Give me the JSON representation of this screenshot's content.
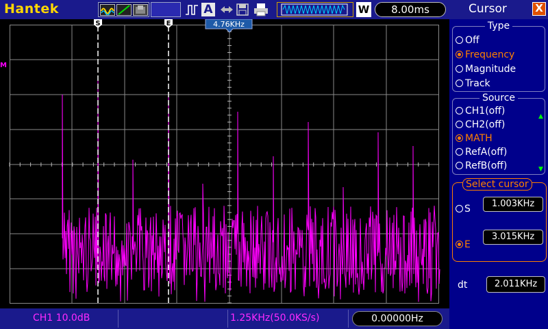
{
  "topbar": {
    "brand": "Hantek",
    "auto_label": "A",
    "w_label": "W",
    "timebase": "8.00ms"
  },
  "plot": {
    "cursor_s_label": "S",
    "cursor_e_label": "E",
    "trigger_freq_label": "4.76KHz",
    "math_marker": "M",
    "trace_color": "#ff00ff"
  },
  "status": {
    "ch1_scale": "CH1 10.0dB",
    "horizontal": "1.25KHz(50.0KS/s)",
    "frequency": "0.00000Hz"
  },
  "panel": {
    "title": "Cursor",
    "close_label": "X",
    "type_group": {
      "title": "Type",
      "options": [
        "Off",
        "Frequency",
        "Magnitude",
        "Track"
      ],
      "selected": "Frequency"
    },
    "source_group": {
      "title": "Source",
      "options": [
        "CH1(off)",
        "CH2(off)",
        "MATH",
        "RefA(off)",
        "RefB(off)"
      ],
      "selected": "MATH"
    },
    "select_cursor": {
      "title": "Select cursor",
      "s_label": "S",
      "s_value": "1.003KHz",
      "e_label": "E",
      "e_value": "3.015KHz",
      "selected": "E"
    },
    "dt_label": "dt",
    "dt_value": "2.011KHz"
  }
}
